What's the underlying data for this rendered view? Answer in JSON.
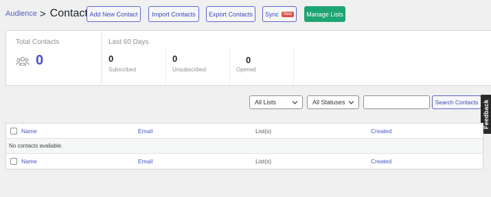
{
  "breadcrumb": {
    "parent": "Audience",
    "separator": ">",
    "current": "Contacts"
  },
  "toolbar": {
    "add_contact": "Add New Contact",
    "import_contacts": "Import Contacts",
    "export_contacts": "Export Contacts",
    "sync": "Sync",
    "sync_badge": "New",
    "manage_lists": "Manage Lists"
  },
  "stats": {
    "total_label": "Total Contacts",
    "total_value": "0",
    "period_label": "Last 60 Days",
    "subscribed_value": "0",
    "subscribed_label": "Subscribed",
    "unsubscribed_value": "0",
    "unsubscribed_label": "Unsubscribed",
    "opened_value": "0",
    "opened_label": "Opened"
  },
  "filters": {
    "list_select": "All Lists",
    "status_select": "All Statuses",
    "search_placeholder": "",
    "search_button": "Search Contacts"
  },
  "feedback_tab": "Feedback",
  "table": {
    "columns": [
      "Name",
      "Email",
      "List(s)",
      "Created"
    ],
    "empty_message": "No contacts avaliable."
  },
  "colors": {
    "accent": "#4351c4",
    "primary_button": "#1ea574",
    "badge": "#e0534c",
    "background": "#f0f0f1"
  }
}
